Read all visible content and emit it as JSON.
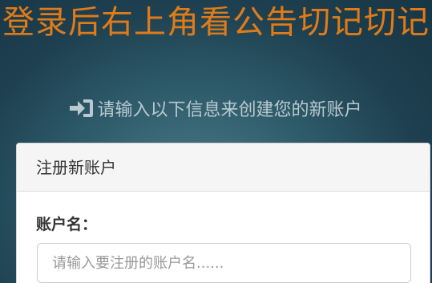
{
  "notice": "登录后右上角看公告切记切记",
  "subtitle": "请输入以下信息来创建您的新账户",
  "subtitle_icon": "sign-in-icon",
  "panel": {
    "heading": "注册新账户",
    "fields": [
      {
        "label": "账户名：",
        "value": "",
        "placeholder": "请输入要注册的账户名......"
      }
    ]
  },
  "colors": {
    "notice": "#e07b18",
    "background": "#2f5c6b",
    "subtitle": "#b9c9cf"
  }
}
